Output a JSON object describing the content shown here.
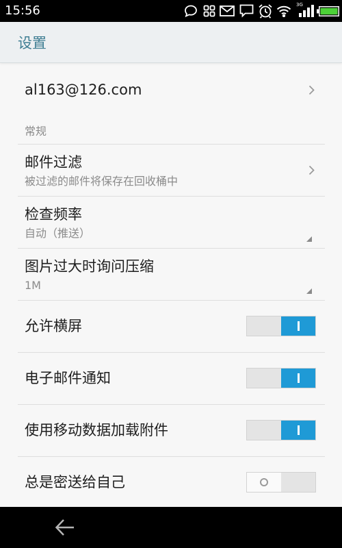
{
  "status_bar": {
    "time": "15:56",
    "network_type": "3G",
    "signal_level": 4,
    "battery_level": 1.0,
    "icons": [
      "chat-bubble-icon",
      "grid-icon",
      "mail-icon",
      "message-icon",
      "alarm-icon",
      "wifi-icon",
      "signal-icon",
      "battery-icon"
    ]
  },
  "app_bar": {
    "title": "设置"
  },
  "account": {
    "email": "al163@126.com",
    "icon": "chevron-right-icon"
  },
  "sections": {
    "general": {
      "header": "常规"
    }
  },
  "settings": {
    "mail_filter": {
      "title": "邮件过滤",
      "subtitle": "被过滤的邮件将保存在回收桶中",
      "icon": "chevron-right-icon"
    },
    "check_frequency": {
      "title": "检查频率",
      "value": "自动（推送）",
      "icon": "dropdown-corner-icon"
    },
    "image_compress": {
      "title": "图片过大时询问压缩",
      "value": "1M",
      "icon": "dropdown-corner-icon"
    },
    "allow_landscape": {
      "title": "允许横屏",
      "enabled": true
    },
    "email_notification": {
      "title": "电子邮件通知",
      "enabled": true
    },
    "mobile_data_attachments": {
      "title": "使用移动数据加载附件",
      "enabled": true
    },
    "always_bcc_self": {
      "title": "总是密送给自己",
      "enabled": false
    }
  },
  "nav_bar": {
    "icons": [
      "back-arrow-icon"
    ]
  },
  "colors": {
    "status_bar_bg": "#000000",
    "app_bar_bg": "#edf0f2",
    "title_accent": "#3f7e93",
    "background": "#f7f7f7",
    "toggle_on": "#1f9ad6",
    "battery": "#4cd137",
    "nav_bar_bg": "#000000"
  }
}
